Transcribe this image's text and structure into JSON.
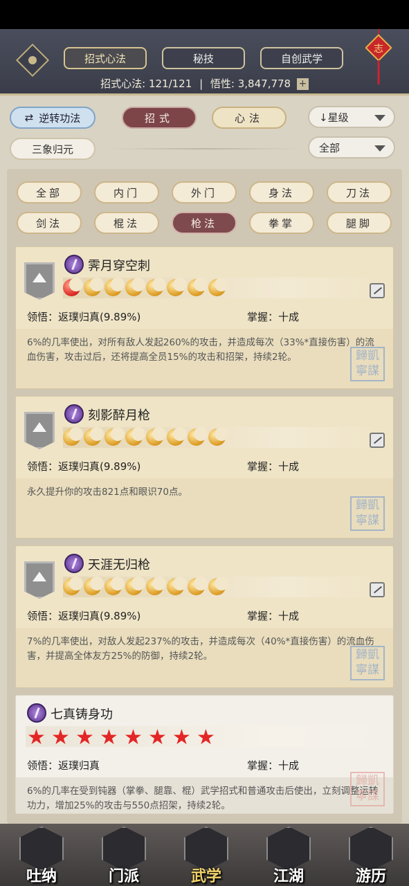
{
  "header": {
    "tabs": [
      {
        "label": "招式心法",
        "active": true
      },
      {
        "label": "秘技",
        "active": false
      },
      {
        "label": "自创武学",
        "active": false
      }
    ],
    "stats_label_1": "招式心法:",
    "stats_value_1": "121/121",
    "stats_sep": "|",
    "stats_label_2": "悟性:",
    "stats_value_2": "3,847,778",
    "plus": "+",
    "knot_char": "志"
  },
  "controls": {
    "reverse_btn": "逆转功法",
    "tab_zhaoshi": "招式",
    "tab_xinfa": "心法",
    "sort_dropdown": "↓星级",
    "sanxiang_btn": "三象归元",
    "filter_dropdown": "全部"
  },
  "categories": [
    "全部",
    "内门",
    "外门",
    "身法",
    "刀法",
    "剑法",
    "棍法",
    "枪法",
    "拳掌",
    "腿脚"
  ],
  "active_category": "枪法",
  "cards": [
    {
      "name": "霁月穿空刺",
      "rank_type": "moon",
      "first_red": true,
      "count": 8,
      "lingwu": "领悟：返璞归真(9.89%)",
      "zhangwo": "掌握：十成",
      "desc": "6%的几率使出，对所有敌人发起260%的攻击，并造成每次（33%*直接伤害）的流血伤害，攻击过后，还将提高全员15%的攻击和招架，持续2轮。",
      "seal": "歸凱 寧謀"
    },
    {
      "name": "刻影醉月枪",
      "rank_type": "moon",
      "first_red": false,
      "count": 8,
      "lingwu": "领悟：返璞归真(9.89%)",
      "zhangwo": "掌握：十成",
      "desc": "永久提升你的攻击821点和眼识70点。",
      "seal": "歸凱 寧謀"
    },
    {
      "name": "天涯无归枪",
      "rank_type": "moon",
      "first_red": false,
      "count": 8,
      "lingwu": "领悟：返璞归真(9.89%)",
      "zhangwo": "掌握：十成",
      "desc": "7%的几率使出，对敌人发起237%的攻击，并造成每次（40%*直接伤害）的流血伤害，并提高全体友方25%的防御，持续2轮。",
      "seal": "歸凱 寧謀"
    },
    {
      "name": "七真铸身功",
      "rank_type": "star",
      "first_red": false,
      "count": 8,
      "lingwu": "领悟：返璞归真",
      "zhangwo": "掌握：十成",
      "desc": "6%的几率在受到钝器（掌拳、腿靠、棍）武学招式和普通攻击后使出，立刻调整运转功力，增加25%的攻击与550点招架，持续2轮。",
      "seal": "歸凱 寧謀"
    }
  ],
  "nav": [
    {
      "label": "吐纳",
      "icon": "monk-icon",
      "active": false
    },
    {
      "label": "门派",
      "icon": "flags-icon",
      "active": false
    },
    {
      "label": "武学",
      "icon": "book-icon",
      "active": true
    },
    {
      "label": "江湖",
      "icon": "straw-hat-icon",
      "active": false
    },
    {
      "label": "游历",
      "icon": "horse-icon",
      "active": false
    }
  ]
}
